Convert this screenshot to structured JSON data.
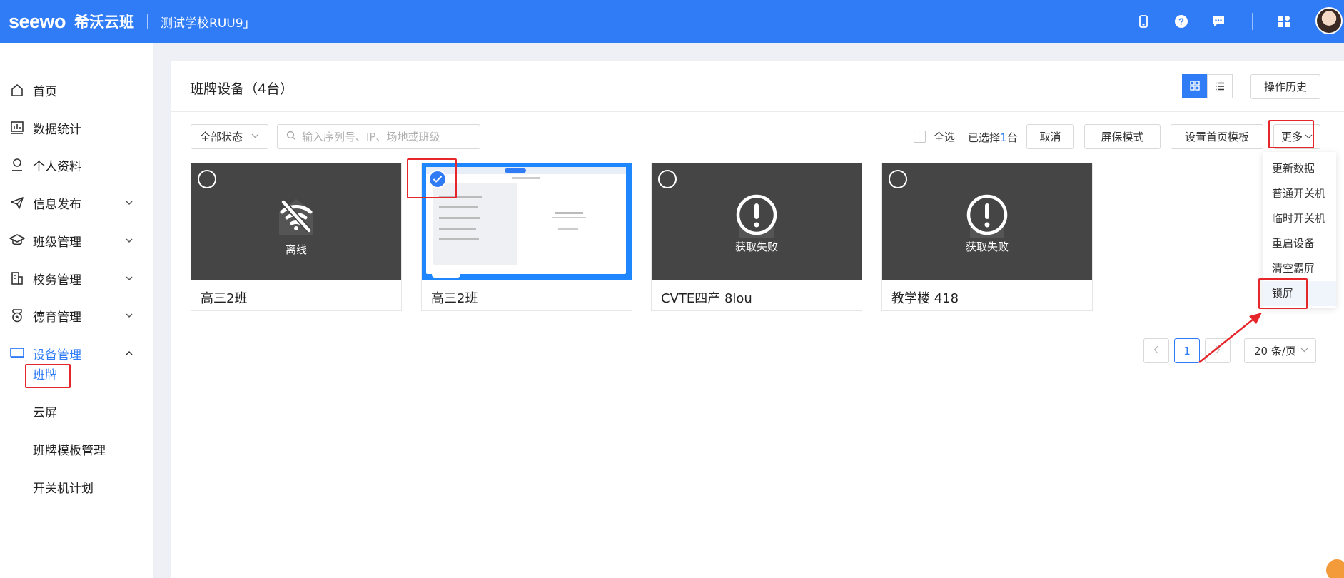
{
  "header": {
    "logo": "seewo",
    "product": "希沃云班",
    "school": "测试学校RUU9」",
    "icons": [
      "phone-icon",
      "help-icon",
      "message-icon",
      "apps-icon"
    ]
  },
  "sidebar": {
    "items": [
      {
        "label": "首页",
        "icon": "home-icon"
      },
      {
        "label": "数据统计",
        "icon": "chart-icon"
      },
      {
        "label": "个人资料",
        "icon": "user-icon"
      },
      {
        "label": "信息发布",
        "icon": "send-icon"
      },
      {
        "label": "班级管理",
        "icon": "graduation-icon"
      },
      {
        "label": "校务管理",
        "icon": "building-icon"
      },
      {
        "label": "德育管理",
        "icon": "badge-icon"
      },
      {
        "label": "设备管理",
        "icon": "monitor-icon"
      }
    ],
    "sub_items": [
      "班牌",
      "云屏",
      "班牌模板管理",
      "开关机计划"
    ],
    "active_sub": "班牌"
  },
  "main": {
    "title": "班牌设备（4台）",
    "history_button": "操作历史",
    "status_filter": "全部状态",
    "search_placeholder": "输入序列号、IP、场地或班级",
    "select_all": "全选",
    "selected_prefix": "已选择",
    "selected_count": "1",
    "selected_suffix": "台",
    "cancel_button": "取消",
    "screensaver_button": "屏保模式",
    "home_template_button": "设置首页模板",
    "more_button": "更多"
  },
  "devices": [
    {
      "name": "高三2班",
      "status": "离线",
      "selected": false
    },
    {
      "name": "高三2班",
      "status": "",
      "selected": true
    },
    {
      "name": "CVTE四产 8lou",
      "status": "获取失败",
      "selected": false
    },
    {
      "name": "教学楼 418",
      "status": "获取失败",
      "selected": false
    }
  ],
  "pagination": {
    "current_page": "1",
    "page_size": "20 条/页"
  },
  "more_menu": {
    "items": [
      "更新数据",
      "普通开关机",
      "临时开关机",
      "重启设备",
      "清空霸屏",
      "锁屏"
    ],
    "highlighted": "锁屏"
  },
  "colors": {
    "primary": "#2f7cf6",
    "annotation": "#e5262b",
    "thumb_dark": "#454545"
  }
}
